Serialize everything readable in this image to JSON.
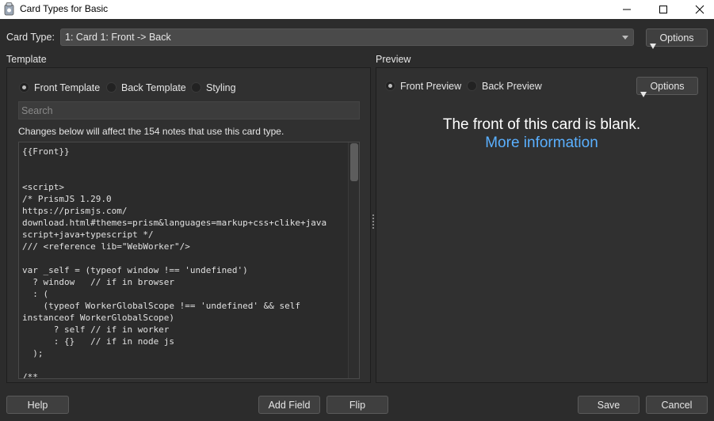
{
  "window": {
    "title": "Card Types for Basic",
    "icon": "anki-app-icon"
  },
  "header": {
    "card_type_label": "Card Type:",
    "card_type_value": "1: Card 1: Front -> Back",
    "options_label": "Options"
  },
  "template": {
    "section_label": "Template",
    "radios": [
      {
        "label": "Front Template",
        "selected": true
      },
      {
        "label": "Back Template",
        "selected": false
      },
      {
        "label": "Styling",
        "selected": false
      }
    ],
    "search_placeholder": "Search",
    "notice": "Changes below will affect the 154 notes that use this card type.",
    "code": "{{Front}}\n\n\n<script>\n/* PrismJS 1.29.0\nhttps://prismjs.com/\ndownload.html#themes=prism&languages=markup+css+clike+java\nscript+java+typescript */\n/// <reference lib=\"WebWorker\"/>\n\nvar _self = (typeof window !== 'undefined')\n  ? window   // if in browser\n  : (\n    (typeof WorkerGlobalScope !== 'undefined' && self\ninstanceof WorkerGlobalScope)\n      ? self // if in worker\n      : {}   // if in node js\n  );\n\n/**"
  },
  "preview": {
    "section_label": "Preview",
    "radios": [
      {
        "label": "Front Preview",
        "selected": true
      },
      {
        "label": "Back Preview",
        "selected": false
      }
    ],
    "options_label": "Options",
    "blank_message": "The front of this card is blank.",
    "more_info": "More information"
  },
  "footer": {
    "help": "Help",
    "add_field": "Add Field",
    "flip": "Flip",
    "save": "Save",
    "cancel": "Cancel"
  },
  "colors": {
    "background": "#2c2c2c",
    "panel": "#303030",
    "link": "#5ab0ff",
    "text": "#e6e6e6"
  }
}
